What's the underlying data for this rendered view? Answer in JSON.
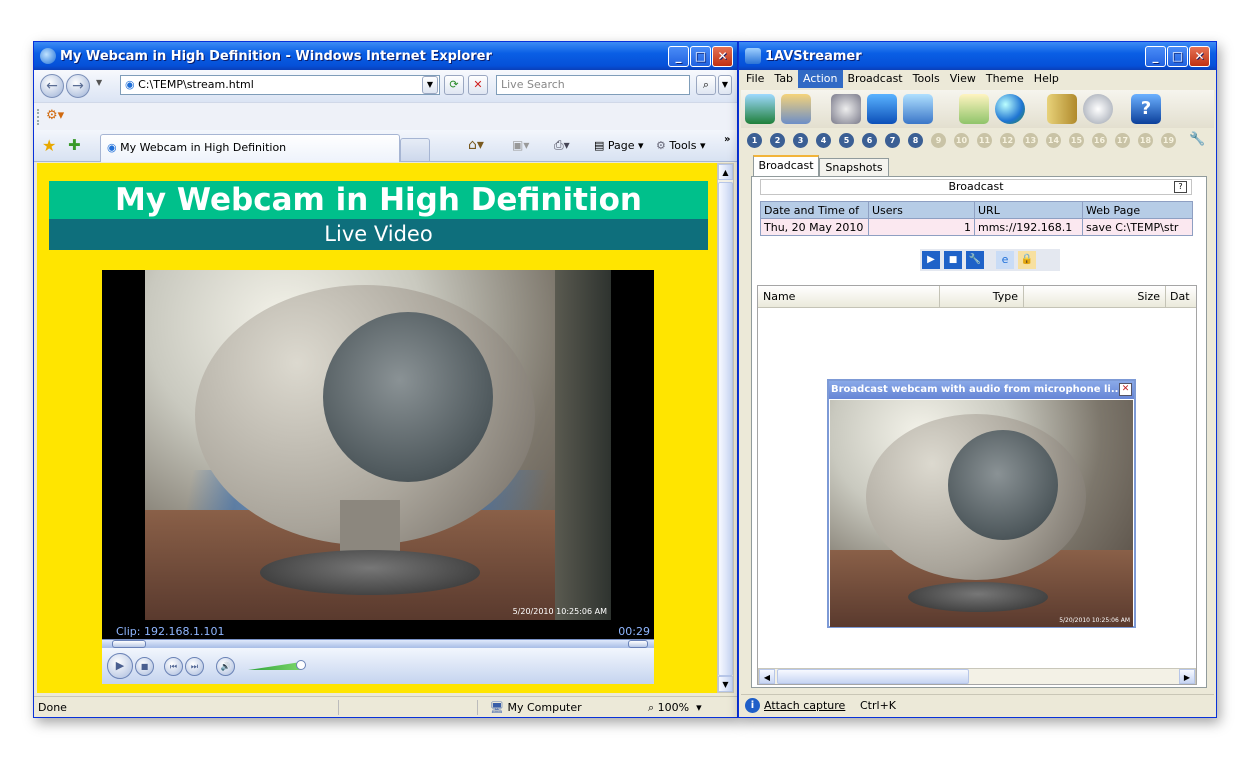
{
  "ie": {
    "title": "My Webcam in High Definition - Windows Internet Explorer",
    "address": "C:\\TEMP\\stream.html",
    "search_placeholder": "Live Search",
    "tab_label": "My Webcam in High Definition",
    "toolbar_page": "Page",
    "toolbar_tools": "Tools",
    "page": {
      "heading": "My Webcam in High Definition",
      "subheading": "Live Video"
    },
    "player": {
      "timestamp": "5/20/2010 10:25:06 AM",
      "clip_label": "Clip: 192.168.1.101",
      "time": "00:29",
      "volume_fraction": 0.85
    },
    "status": {
      "text": "Done",
      "zone": "My Computer",
      "zoom": "100%"
    }
  },
  "streamer": {
    "title": "1AVStreamer",
    "menu": [
      "File",
      "Tab",
      "Action",
      "Broadcast",
      "Tools",
      "View",
      "Theme",
      "Help"
    ],
    "active_menu": "Action",
    "numbers": [
      "1",
      "2",
      "3",
      "4",
      "5",
      "6",
      "7",
      "8",
      "9",
      "10",
      "11",
      "12",
      "13",
      "14",
      "15",
      "16",
      "17",
      "18",
      "19"
    ],
    "tabs": [
      "Broadcast",
      "Snapshots"
    ],
    "panel_title": "Broadcast",
    "help_glyph": "?",
    "table": {
      "headers": [
        "Date and Time of",
        "Users",
        "URL",
        "Web Page"
      ],
      "row": [
        "Thu, 20 May 2010",
        "1",
        "mms://192.168.1",
        "save C:\\TEMP\\str"
      ]
    },
    "list_headers": [
      "Name",
      "Type",
      "Size",
      "Dat"
    ],
    "preview_title": "Broadcast webcam with audio from microphone li...",
    "preview_timestamp": "5/20/2010 10:25:06 AM",
    "status": {
      "action": "Attach capture",
      "shortcut": "Ctrl+K"
    }
  },
  "colors": {
    "xp_blue": "#0a5fe5",
    "page_yellow": "#ffe500",
    "heading_green": "#00c08b",
    "heading_teal": "#0e6f7c",
    "active_menu": "#316ac5"
  }
}
